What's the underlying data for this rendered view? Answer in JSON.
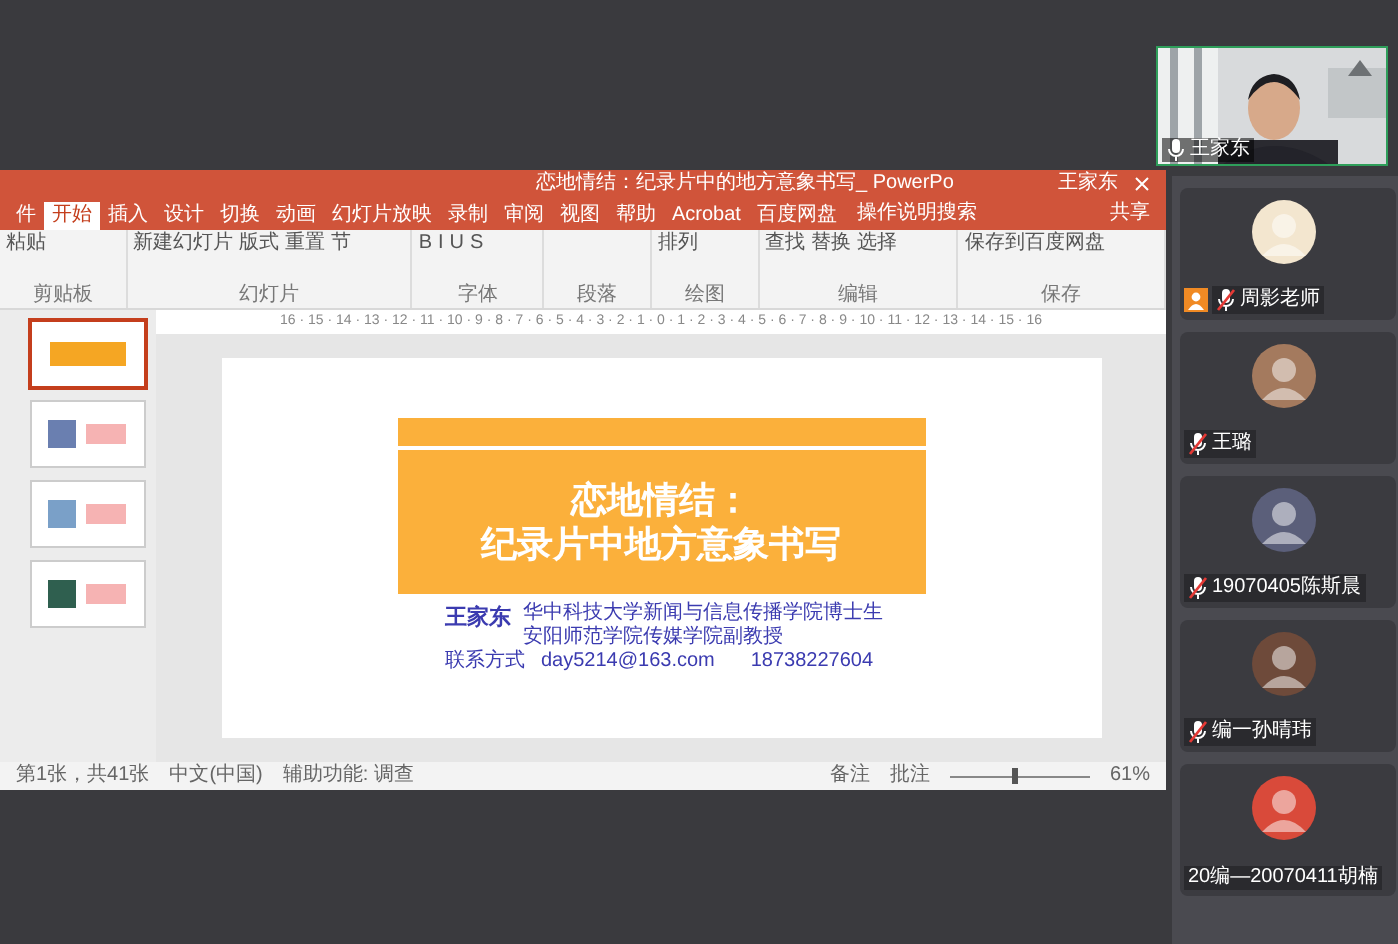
{
  "ppt": {
    "title": "恋地情结：纪录片中的地方意象书写_ PowerPo",
    "user": "王家东",
    "tabs": [
      {
        "label": "件",
        "selected": false
      },
      {
        "label": "开始",
        "selected": true
      },
      {
        "label": "插入",
        "selected": false
      },
      {
        "label": "设计",
        "selected": false
      },
      {
        "label": "切换",
        "selected": false
      },
      {
        "label": "动画",
        "selected": false
      },
      {
        "label": "幻灯片放映",
        "selected": false
      },
      {
        "label": "录制",
        "selected": false
      },
      {
        "label": "审阅",
        "selected": false
      },
      {
        "label": "视图",
        "selected": false
      },
      {
        "label": "帮助",
        "selected": false
      },
      {
        "label": "Acrobat",
        "selected": false
      },
      {
        "label": "百度网盘",
        "selected": false
      }
    ],
    "search": "操作说明搜索",
    "share": "共享",
    "ribbon_groups": [
      {
        "label": "剪贴板",
        "items": [
          "粘贴"
        ]
      },
      {
        "label": "幻灯片",
        "items": [
          "新建幻灯片",
          "版式",
          "重置",
          "节"
        ]
      },
      {
        "label": "字体",
        "items": [
          "B",
          "I",
          "U",
          "S"
        ]
      },
      {
        "label": "段落"
      },
      {
        "label": "绘图",
        "items": [
          "排列"
        ]
      },
      {
        "label": "编辑",
        "items": [
          "查找",
          "替换",
          "选择"
        ]
      },
      {
        "label": "保存",
        "items": [
          "保存到百度网盘"
        ]
      }
    ],
    "ruler": "16 · 15 · 14 · 13 · 12 · 11 · 10 · 9 · 8 · 7 · 6 · 5 · 4 · 3 · 2 · 1 · 0 · 1 · 2 · 3 · 4 · 5 · 6 · 7 · 8 · 9 · 10 · 11 · 12 · 13 · 14 · 15 · 16",
    "thumbnails": [
      {
        "selected": true
      },
      {
        "selected": false
      },
      {
        "selected": false
      },
      {
        "selected": false
      }
    ],
    "slide": {
      "title_lines": [
        "恋地情结：",
        "纪录片中地方意象书写"
      ],
      "author": "王家东",
      "affiliations": [
        "华中科技大学新闻与信息传播学院博士生",
        "安阳师范学院传媒学院副教授"
      ],
      "contact_label": "联系方式",
      "email": "day5214@163.com",
      "phone": "18738227604"
    },
    "status_bar": {
      "slide_count": "第1张，共41张",
      "language": "中文(中国)",
      "accessibility": "辅助功能: 调查",
      "notes": "备注",
      "comments": "批注",
      "zoom": "61%",
      "level": 0.45
    }
  },
  "camera": {
    "name": "王家东"
  },
  "participants": [
    {
      "name": "周影老师",
      "muted": true,
      "host": true
    },
    {
      "name": "王璐",
      "muted": true,
      "host": false
    },
    {
      "name": "19070405陈斯晨",
      "muted": true,
      "host": false
    },
    {
      "name": "编一孙晴玮",
      "muted": true,
      "host": false
    },
    {
      "name": "20编—20070411胡楠",
      "muted": false,
      "host": false
    }
  ]
}
